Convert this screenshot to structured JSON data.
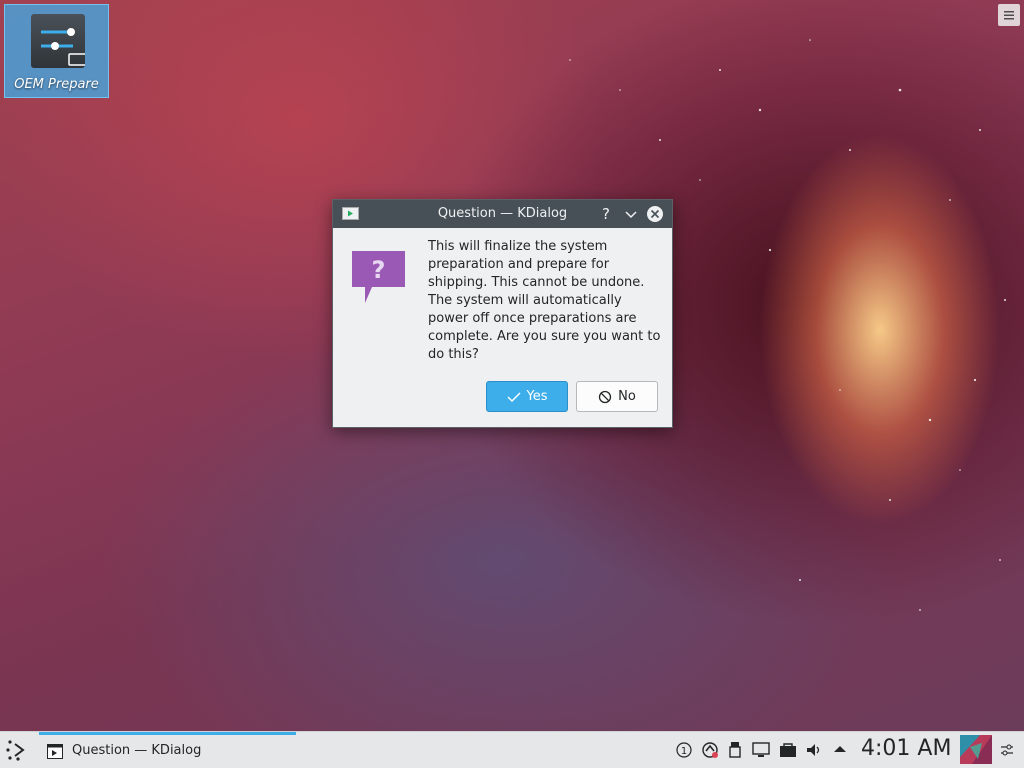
{
  "desktop": {
    "icon_label": "OEM Prepare"
  },
  "dialog": {
    "title": "Question — KDialog",
    "message": "This will finalize the system preparation and prepare for shipping. This cannot be undone. The system will automatically power off once preparations are complete. Are you sure you want to do this?",
    "yes_label": "Yes",
    "no_label": "No",
    "help_glyph": "?"
  },
  "taskbar": {
    "task_label": "Question — KDialog",
    "clock": "4:01 AM"
  },
  "colors": {
    "accent": "#3daee9",
    "titlebar": "#475057",
    "question_icon": "#9b59b6"
  },
  "icons": [
    "settings-sliders-icon",
    "kdialog-app-icon",
    "help-icon",
    "minimize-chevron-icon",
    "close-icon",
    "question-bubble-icon",
    "checkmark-icon",
    "cancel-icon",
    "application-launcher-icon",
    "notification-count-icon",
    "updates-icon",
    "usb-device-icon",
    "network-icon",
    "vault-icon",
    "volume-icon",
    "expand-tray-icon",
    "pager-desktop-icon",
    "panel-settings-icon"
  ]
}
